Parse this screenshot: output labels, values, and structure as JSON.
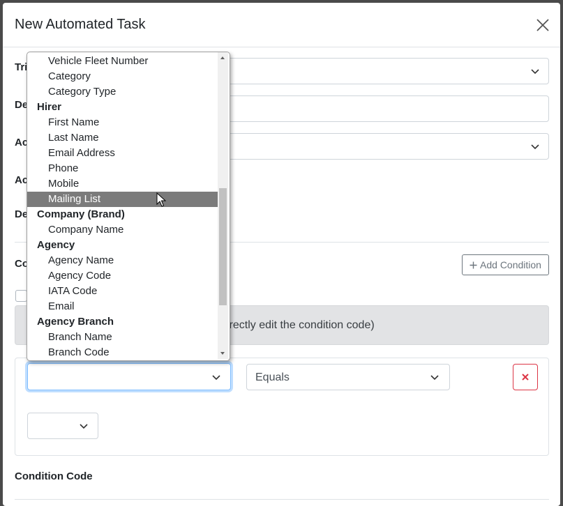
{
  "modal": {
    "title": "New Automated Task",
    "labels": {
      "trigger": "Tri",
      "description": "De",
      "action": "Ac",
      "action_2": "Ac",
      "details": "De",
      "conditions": "Co",
      "condition_code": "Condition Code"
    }
  },
  "conditions": {
    "add_label": "Add Condition",
    "alert_text": "irectly edit the condition code)",
    "operator_value": "Equals",
    "field_value": "",
    "value_value": ""
  },
  "dropdown": {
    "items": [
      {
        "type": "option",
        "label": "Vehicle Fleet Number"
      },
      {
        "type": "option",
        "label": "Category"
      },
      {
        "type": "option",
        "label": "Category Type"
      },
      {
        "type": "group",
        "label": "Hirer"
      },
      {
        "type": "option",
        "label": "First Name"
      },
      {
        "type": "option",
        "label": "Last Name"
      },
      {
        "type": "option",
        "label": "Email Address"
      },
      {
        "type": "option",
        "label": "Phone"
      },
      {
        "type": "option",
        "label": "Mobile"
      },
      {
        "type": "option",
        "label": "Mailing List",
        "selected": true
      },
      {
        "type": "group",
        "label": "Company (Brand)"
      },
      {
        "type": "option",
        "label": "Company Name"
      },
      {
        "type": "group",
        "label": "Agency"
      },
      {
        "type": "option",
        "label": "Agency Name"
      },
      {
        "type": "option",
        "label": "Agency Code"
      },
      {
        "type": "option",
        "label": "IATA Code"
      },
      {
        "type": "option",
        "label": "Email"
      },
      {
        "type": "group",
        "label": "Agency Branch"
      },
      {
        "type": "option",
        "label": "Branch Name"
      },
      {
        "type": "option",
        "label": "Branch Code"
      }
    ]
  },
  "colors": {
    "danger": "#dc3545",
    "focus": "#80bdff",
    "highlight": "#7b7b7b"
  }
}
